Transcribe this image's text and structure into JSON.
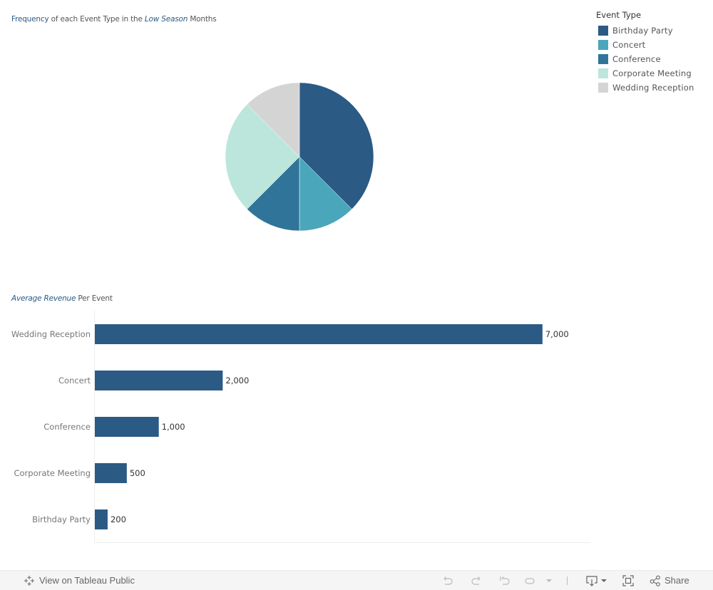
{
  "pie_title": {
    "part1": "Frequency",
    "part2": " of each Event Type in the ",
    "part3": "Low Season",
    "part4": " Months"
  },
  "bar_title": {
    "part1": "Average Revenue",
    "part2": " Per Event"
  },
  "legend": {
    "title": "Event Type",
    "items": [
      {
        "label": "Birthday Party",
        "color": "#2b5a85"
      },
      {
        "label": "Concert",
        "color": "#4aa6bb"
      },
      {
        "label": "Conference",
        "color": "#307599"
      },
      {
        "label": "Corporate Meeting",
        "color": "#bce6db"
      },
      {
        "label": "Wedding Reception",
        "color": "#d4d4d4"
      }
    ]
  },
  "chart_data": [
    {
      "type": "pie",
      "title": "Frequency of each Event Type in the Low Season Months",
      "categories": [
        "Birthday Party",
        "Concert",
        "Conference",
        "Corporate Meeting",
        "Wedding Reception"
      ],
      "values": [
        3,
        1,
        1,
        2,
        1
      ],
      "colors": [
        "#2b5a85",
        "#4aa6bb",
        "#307599",
        "#bce6db",
        "#d4d4d4"
      ],
      "legend": "top-right"
    },
    {
      "type": "bar",
      "orientation": "horizontal",
      "title": "Average Revenue Per Event",
      "categories": [
        "Wedding Reception",
        "Concert",
        "Conference",
        "Corporate Meeting",
        "Birthday Party"
      ],
      "values": [
        7000,
        2000,
        1000,
        500,
        200
      ],
      "labels": [
        "7,000",
        "2,000",
        "1,000",
        "500",
        "200"
      ],
      "xlim": [
        0,
        7760
      ],
      "color": "#2b5a85",
      "xlabel": "",
      "ylabel": "",
      "grid": false
    }
  ],
  "toolbar": {
    "view_label": "View on Tableau Public",
    "share_label": "Share"
  }
}
